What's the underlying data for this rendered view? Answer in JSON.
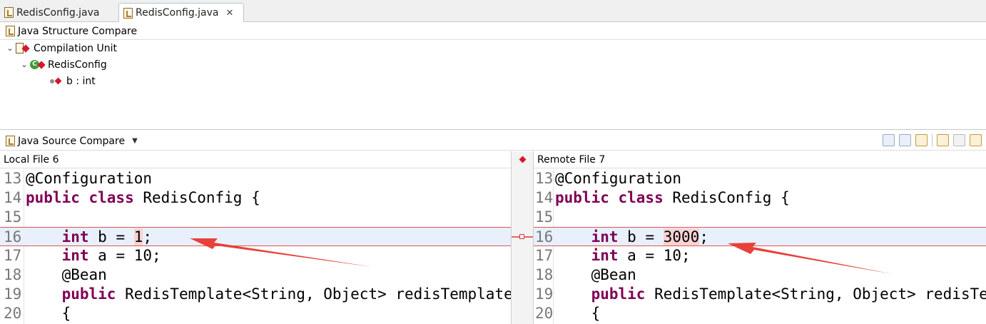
{
  "tabs": [
    {
      "label": "RedisConfig.java",
      "active": false
    },
    {
      "label": "RedisConfig.java",
      "active": true,
      "close": "✕"
    }
  ],
  "structure": {
    "title": "Java Structure Compare",
    "tree": [
      {
        "label": "Compilation Unit",
        "icon": "compilation-unit-icon"
      },
      {
        "label": "RedisConfig",
        "icon": "class-icon"
      },
      {
        "label": "b : int",
        "icon": "field-icon"
      }
    ]
  },
  "source": {
    "title": "Java Source Compare",
    "left_label": "Local File 6",
    "right_label": "Remote File 7"
  },
  "code": {
    "left": [
      {
        "n": "13",
        "text": "@Configuration"
      },
      {
        "n": "14",
        "kw": "public class",
        "text": " RedisConfig {"
      },
      {
        "n": "15",
        "text": ""
      },
      {
        "n": "16",
        "kw": "    int",
        "pre": " b = ",
        "chg": "1",
        "post": ";"
      },
      {
        "n": "17",
        "kw": "    int",
        "text": " a = 10;"
      },
      {
        "n": "18",
        "text": "    @Bean"
      },
      {
        "n": "19",
        "kw": "    public",
        "text": " RedisTemplate<String, Object> redisTemplate"
      },
      {
        "n": "20",
        "text": "    {"
      }
    ],
    "right": [
      {
        "n": "13",
        "text": "@Configuration"
      },
      {
        "n": "14",
        "kw": "public class",
        "text": " RedisConfig {"
      },
      {
        "n": "15",
        "text": ""
      },
      {
        "n": "16",
        "kw": "    int",
        "pre": " b = ",
        "chg": "3000",
        "post": ";"
      },
      {
        "n": "17",
        "kw": "    int",
        "text": " a = 10;"
      },
      {
        "n": "18",
        "text": "    @Bean"
      },
      {
        "n": "19",
        "kw": "    public",
        "text": " RedisTemplate<String, Object> redisTemplate"
      },
      {
        "n": "20",
        "text": "    {"
      }
    ]
  },
  "colors": {
    "keyword": "#7f0055",
    "diff": "#e05555",
    "arrow": "#e8403a"
  }
}
